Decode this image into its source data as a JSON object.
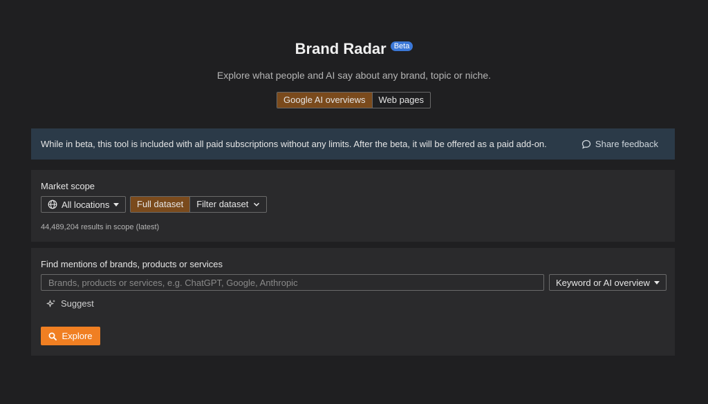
{
  "header": {
    "title": "Brand Radar",
    "badge": "Beta",
    "subtitle": "Explore what people and AI say about any brand, topic or niche."
  },
  "source_tabs": [
    {
      "label": "Google AI overviews",
      "active": true
    },
    {
      "label": "Web pages",
      "active": false
    }
  ],
  "notice": {
    "text": "While in beta, this tool is included with all paid subscriptions without any limits. After the beta, it will be offered as a paid add-on.",
    "feedback_label": "Share feedback"
  },
  "scope": {
    "label": "Market scope",
    "location_label": "All locations",
    "dataset_options": [
      "Full dataset",
      "Filter dataset"
    ],
    "results_text": "44,489,204 results in scope (latest)"
  },
  "find": {
    "label": "Find mentions of brands, products or services",
    "input_value": "",
    "input_placeholder": "Brands, products or services, e.g. ChatGPT, Google, Anthropic",
    "mode_label": "Keyword or AI overview",
    "suggest_label": "Suggest",
    "explore_label": "Explore"
  },
  "colors": {
    "background": "#1f1f21",
    "panel": "#2a2a2c",
    "notice": "#2b3a48",
    "active_segment": "#7a4a1c",
    "accent": "#f07f22",
    "badge": "#3b78d8"
  },
  "icons": [
    "globe-icon",
    "chevron-down-icon",
    "speech-bubble-icon",
    "sparkle-icon",
    "search-icon"
  ]
}
